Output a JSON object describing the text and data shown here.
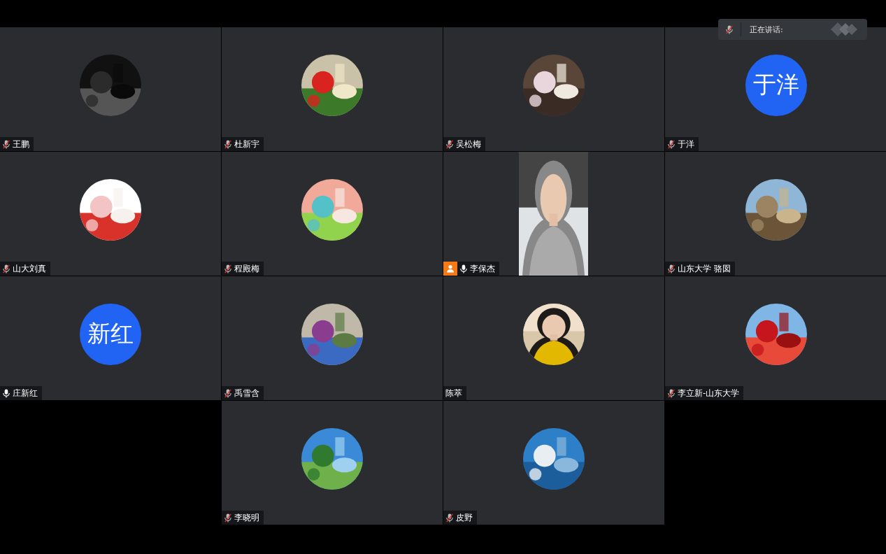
{
  "speaking": {
    "label": "正在讲话:",
    "muted": true
  },
  "tiles": [
    {
      "name": "王鹏",
      "muted": true,
      "host": false
    },
    {
      "name": "杜新宇",
      "muted": true,
      "host": false
    },
    {
      "name": "吴松梅",
      "muted": true,
      "host": false
    },
    {
      "name": "于洋",
      "muted": true,
      "host": false,
      "avatar": {
        "kind": "text",
        "text": "于洋"
      }
    },
    {
      "name": "山大刘真",
      "muted": true,
      "host": false
    },
    {
      "name": "程殿梅",
      "muted": true,
      "host": false
    },
    {
      "name": "李保杰",
      "muted": false,
      "host": true,
      "avatar": {
        "kind": "video"
      }
    },
    {
      "name": "山东大学 骆囡",
      "muted": true,
      "host": false
    },
    {
      "name": "庄新红",
      "muted": false,
      "host": false,
      "avatar": {
        "kind": "text",
        "text": "新红"
      }
    },
    {
      "name": "禹雪含",
      "muted": true,
      "host": false
    },
    {
      "name": "陈萃",
      "host": false
    },
    {
      "name": "李立新-山东大学",
      "muted": true,
      "host": false
    },
    {
      "name": "李晓明",
      "muted": true,
      "host": false
    },
    {
      "name": "皮野",
      "muted": true,
      "host": false
    }
  ]
}
